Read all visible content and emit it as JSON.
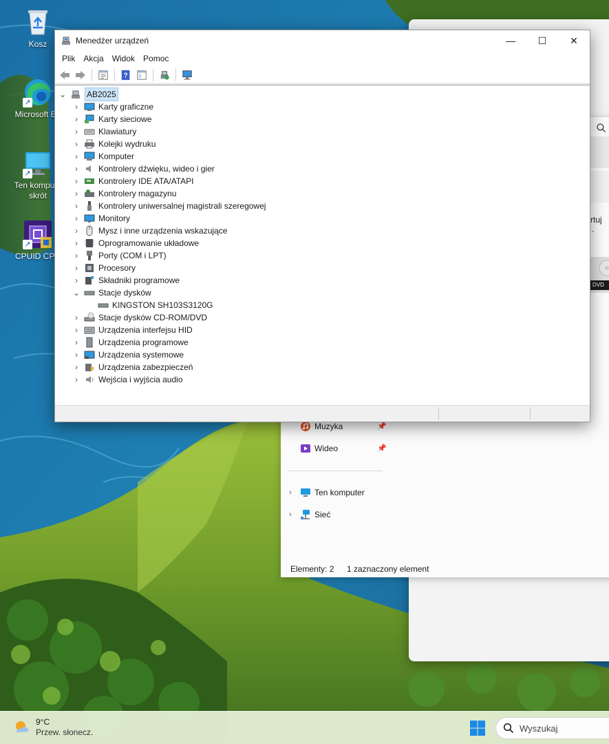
{
  "desktop": {
    "icons": [
      {
        "label": "Kosz",
        "icon": "recycle-bin-icon"
      },
      {
        "label": "Microsoft Ed",
        "icon": "edge-icon"
      },
      {
        "label": "Ten kompute",
        "label2": "skrót",
        "icon": "monitor-icon"
      },
      {
        "label": "CPUID CPU",
        "icon": "cpuid-icon"
      }
    ]
  },
  "device_manager": {
    "title": "Menedżer urządzeń",
    "window_controls": {
      "minimize": "—",
      "maximize": "☐",
      "close": "✕"
    },
    "menu": [
      "Plik",
      "Akcja",
      "Widok",
      "Pomoc"
    ],
    "toolbar": [
      "back-icon",
      "forward-icon",
      "properties-icon",
      "help-icon",
      "view-icon",
      "scan-hardware-icon",
      "monitor-icon"
    ],
    "tree": {
      "root": "AB2025",
      "categories": [
        {
          "label": "Karty graficzne",
          "icon": "display-adapter-icon",
          "expanded": false
        },
        {
          "label": "Karty sieciowe",
          "icon": "network-adapter-icon",
          "expanded": false
        },
        {
          "label": "Klawiatury",
          "icon": "keyboard-icon",
          "expanded": false
        },
        {
          "label": "Kolejki wydruku",
          "icon": "printer-icon",
          "expanded": false
        },
        {
          "label": "Komputer",
          "icon": "computer-icon",
          "expanded": false
        },
        {
          "label": "Kontrolery dźwięku, wideo i gier",
          "icon": "speaker-icon",
          "expanded": false
        },
        {
          "label": "Kontrolery IDE ATA/ATAPI",
          "icon": "ide-controller-icon",
          "expanded": false
        },
        {
          "label": "Kontrolery magazynu",
          "icon": "storage-controller-icon",
          "expanded": false
        },
        {
          "label": "Kontrolery uniwersalnej magistrali szeregowej",
          "icon": "usb-icon",
          "expanded": false
        },
        {
          "label": "Monitory",
          "icon": "monitor-icon",
          "expanded": false
        },
        {
          "label": "Mysz i inne urządzenia wskazujące",
          "icon": "mouse-icon",
          "expanded": false
        },
        {
          "label": "Oprogramowanie układowe",
          "icon": "firmware-icon",
          "expanded": false
        },
        {
          "label": "Porty (COM i LPT)",
          "icon": "port-icon",
          "expanded": false
        },
        {
          "label": "Procesory",
          "icon": "processor-icon",
          "expanded": false
        },
        {
          "label": "Składniki programowe",
          "icon": "software-component-icon",
          "expanded": false
        },
        {
          "label": "Stacje dysków",
          "icon": "disk-drive-icon",
          "expanded": true,
          "children": [
            {
              "label": "KINGSTON SH103S3120G",
              "icon": "disk-drive-icon"
            }
          ]
        },
        {
          "label": "Stacje dysków CD-ROM/DVD",
          "icon": "dvd-drive-icon",
          "expanded": false
        },
        {
          "label": "Urządzenia interfejsu HID",
          "icon": "hid-icon",
          "expanded": false
        },
        {
          "label": "Urządzenia programowe",
          "icon": "software-device-icon",
          "expanded": false
        },
        {
          "label": "Urządzenia systemowe",
          "icon": "system-device-icon",
          "expanded": false
        },
        {
          "label": "Urządzenia zabezpieczeń",
          "icon": "security-device-icon",
          "expanded": false
        },
        {
          "label": "Wejścia i wyjścia audio",
          "icon": "audio-io-icon",
          "expanded": false
        }
      ]
    }
  },
  "explorer": {
    "partial_sort_label": "rtuj",
    "partial_dvd_label": "DVD",
    "nav": [
      {
        "label": "Muzyka",
        "icon": "music-icon",
        "pinned": true
      },
      {
        "label": "Wideo",
        "icon": "video-icon",
        "pinned": true
      },
      {
        "label": "Ten komputer",
        "icon": "this-pc-icon",
        "chevron": true
      },
      {
        "label": "Sieć",
        "icon": "network-icon",
        "chevron": true
      }
    ],
    "status_items": "Elementy: 2",
    "status_selected": "1 zaznaczony element"
  },
  "taskbar": {
    "weather_temp": "9°C",
    "weather_condition": "Przew. słonecz.",
    "search_placeholder": "Wyszukaj"
  },
  "colors": {
    "selection": "#cce4f7",
    "accent": "#0078d4",
    "taskbar": "#e6f0d6"
  }
}
